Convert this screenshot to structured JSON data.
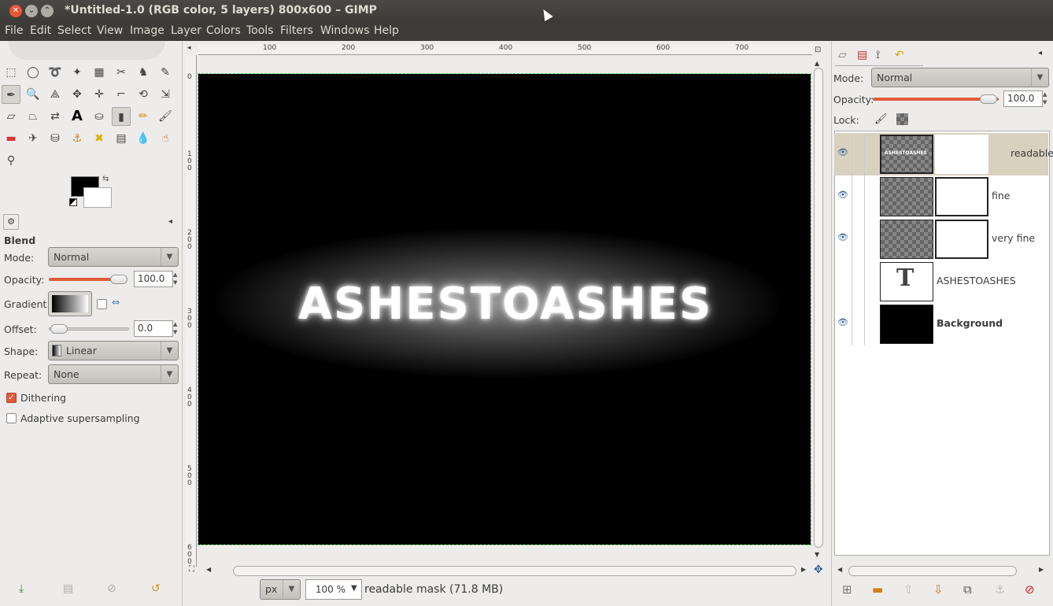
{
  "window": {
    "title": "*Untitled-1.0 (RGB color, 5 layers) 800x600 – GIMP"
  },
  "menu": [
    "File",
    "Edit",
    "Select",
    "View",
    "Image",
    "Layer",
    "Colors",
    "Tools",
    "Filters",
    "Windows",
    "Help"
  ],
  "tool_options": {
    "heading": "Blend",
    "mode_label": "Mode:",
    "mode_value": "Normal",
    "opacity_label": "Opacity:",
    "opacity_value": "100.0",
    "gradient_label": "Gradient:",
    "offset_label": "Offset:",
    "offset_value": "0.0",
    "shape_label": "Shape:",
    "shape_value": "Linear",
    "repeat_label": "Repeat:",
    "repeat_value": "None",
    "dithering_label": "Dithering",
    "dithering_checked": true,
    "adaptive_label": "Adaptive supersampling",
    "adaptive_checked": false
  },
  "canvas": {
    "artwork_text": "ASHESTOASHES",
    "ruler_h_ticks": [
      "100",
      "200",
      "300",
      "400",
      "500",
      "600",
      "700"
    ],
    "ruler_v_ticks": [
      "0",
      "1 0 0",
      "2 0 0",
      "3 0 0",
      "4 0 0",
      "5 0 0",
      "6 0 0"
    ]
  },
  "status": {
    "unit": "px",
    "zoom": "100 %",
    "message": "readable mask (71.8 MB)"
  },
  "layers_panel": {
    "mode_label": "Mode:",
    "mode_value": "Normal",
    "opacity_label": "Opacity:",
    "opacity_value": "100.0",
    "lock_label": "Lock:",
    "layers": [
      {
        "name": "readable",
        "visible": true,
        "selected": true
      },
      {
        "name": "fine",
        "visible": true,
        "selected": false
      },
      {
        "name": "very fine",
        "visible": true,
        "selected": false
      },
      {
        "name": "ASHESTOASHES",
        "visible": false,
        "selected": false
      },
      {
        "name": "Background",
        "visible": true,
        "selected": false
      }
    ],
    "thumb_text": "ASHESTOASHES"
  },
  "colors": {
    "accent": "#e05a3a",
    "selection": "#d9d1bf",
    "titlebar": "#3c3b37"
  }
}
